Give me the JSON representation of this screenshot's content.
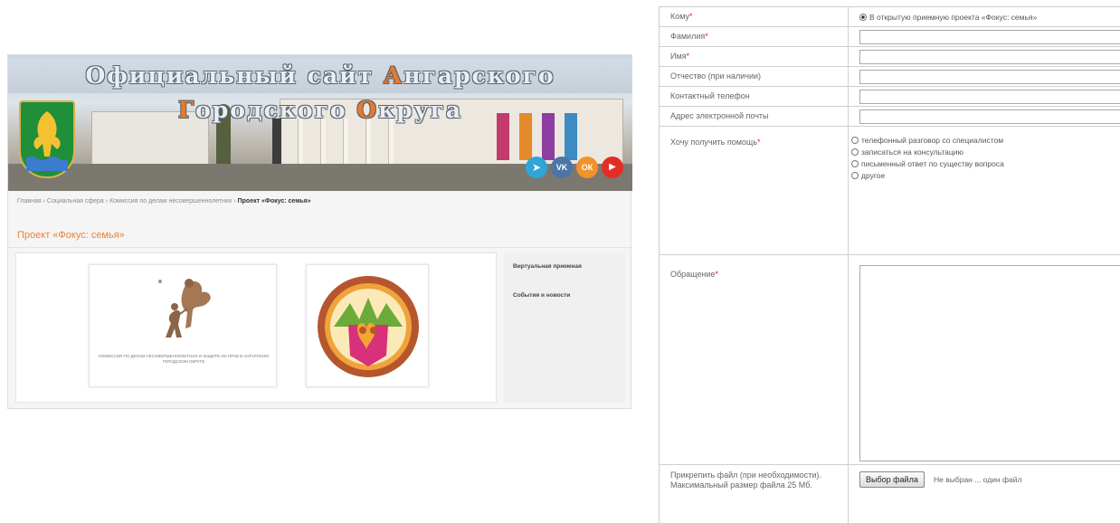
{
  "site": {
    "banner_title_1": "Официальный сайт ",
    "banner_title_a": "А",
    "banner_title_2": "нгарского ",
    "banner_title_g": "Г",
    "banner_title_3": "ородского ",
    "banner_title_o": "О",
    "banner_title_4": "круга",
    "socials": [
      {
        "icon": "telegram-icon",
        "glyph": "➤",
        "color": "#2ea6d9"
      },
      {
        "icon": "vk-icon",
        "glyph": "VK",
        "color": "#4a76a8"
      },
      {
        "icon": "ok-icon",
        "glyph": "ОК",
        "color": "#f2922a"
      },
      {
        "icon": "youtube-icon",
        "glyph": "▶",
        "color": "#e52d27"
      }
    ],
    "breadcrumb": {
      "items": [
        "Главная",
        "Социальная сфера",
        "Комиссия по делам несовершеннолетних"
      ],
      "separator": " › ",
      "current": "Проект «Фокус: семья»"
    },
    "page_title": "Проект «Фокус: семья»",
    "card1_caption": "КОМИССИЯ ПО ДЕЛАМ НЕСОВЕРШЕННОЛЕТНИХ И ЗАЩИТЕ ИХ ПРАВ В АНГАРСКОМ ГОРОДСКОМ ОКРУГЕ",
    "sidebar": [
      "Виртуальная приемная",
      "События и новости"
    ]
  },
  "form": {
    "to_label": "Кому",
    "to_value": "В открытую приемную проекта «Фокус: семья»",
    "surname_label": "Фамилия",
    "name_label": "Имя",
    "patronymic_label": "Отчество (при наличии)",
    "phone_label": "Контактный телефон",
    "email_label": "Адрес электронной почты",
    "help_label": "Хочу получить помощь",
    "help_options": [
      "телефонный разговор со специалистом",
      "записаться на консультацию",
      "письменный ответ по существу вопроса",
      "другое"
    ],
    "message_label": "Обращение",
    "attach_label": "Прикрепить файл (при необходимости). Максимальный размер файла 25 Мб.",
    "file_button": "Выбор файла",
    "file_status": "Не выбран ... один файл",
    "required_mark": "*"
  }
}
